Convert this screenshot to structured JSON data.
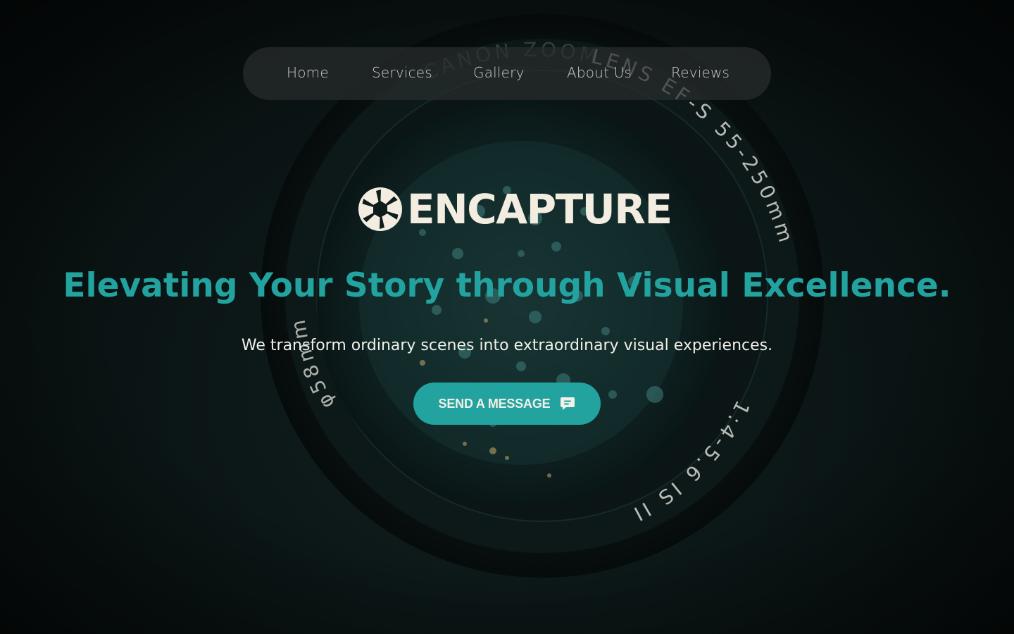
{
  "nav": {
    "items": [
      {
        "label": "Home"
      },
      {
        "label": "Services"
      },
      {
        "label": "Gallery"
      },
      {
        "label": "About Us"
      },
      {
        "label": "Reviews"
      }
    ]
  },
  "brand": {
    "name": "ENCAPTURE",
    "logo_icon": "aperture-icon"
  },
  "hero": {
    "headline": "Elevating Your Story through Visual Excellence.",
    "subheadline": "We transform ordinary scenes into extraordinary visual experiences.",
    "cta_label": "SEND A MESSAGE",
    "cta_icon": "chat-bubble-icon"
  },
  "background": {
    "lens_text_top": "CANON ZOOM LENS EF-S 55-250mm",
    "lens_text_side": "1:4-5.6 IS II",
    "lens_text_left": "φ58mm"
  },
  "colors": {
    "accent": "#23a39f",
    "brand_text": "#f2ede0",
    "nav_text": "#c8cbc9",
    "background": "#0a1212"
  }
}
